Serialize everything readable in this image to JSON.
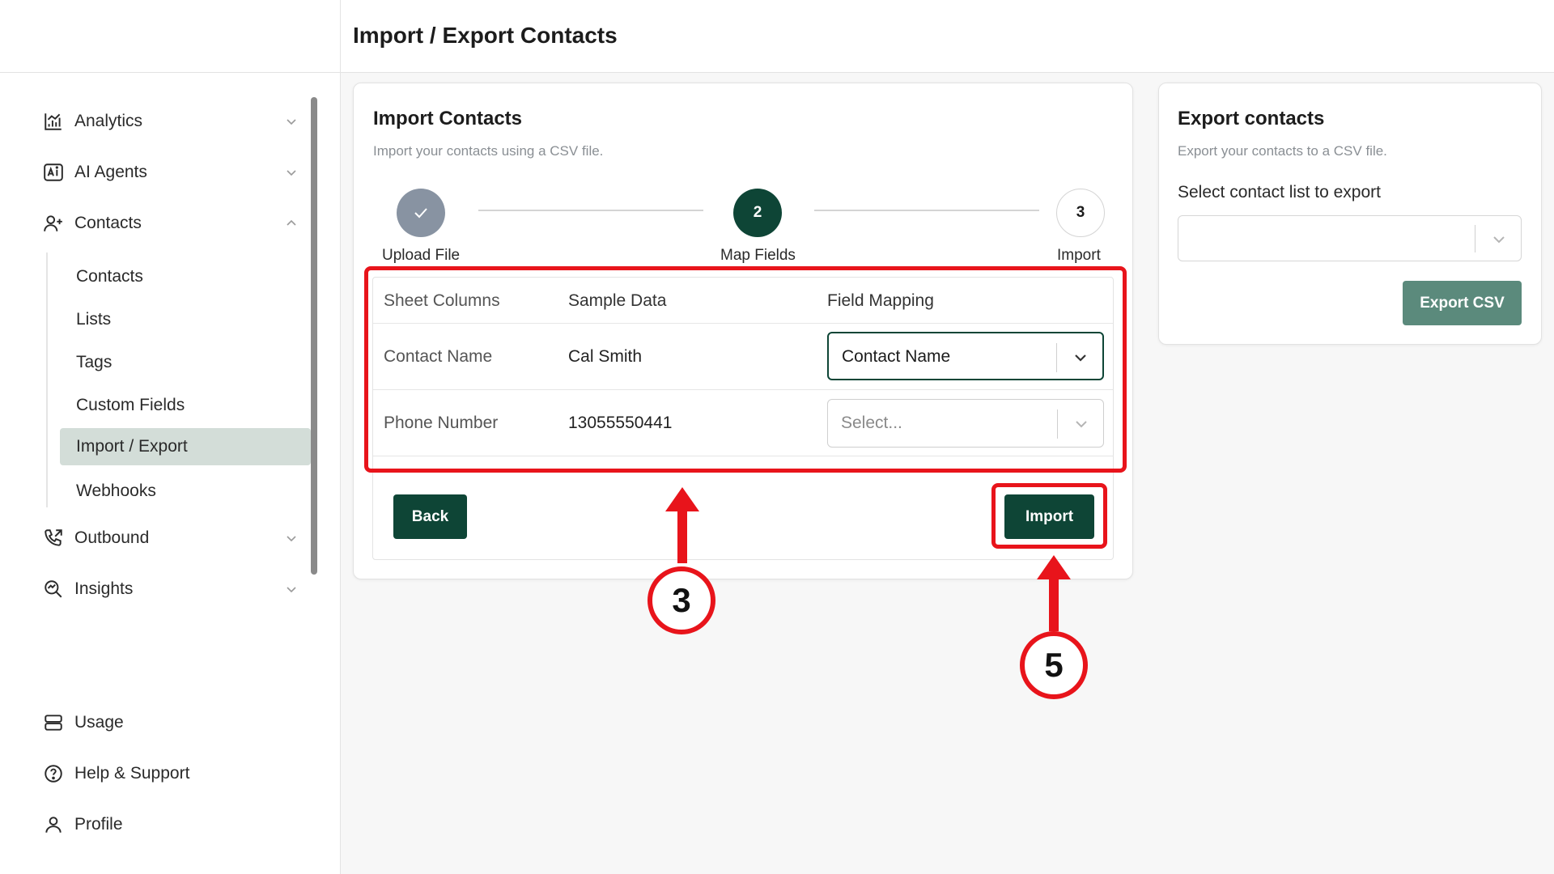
{
  "header": {
    "title": "Import / Export Contacts"
  },
  "sidebar": {
    "items": [
      {
        "label": "Analytics",
        "icon": "analytics-icon",
        "expanded": false
      },
      {
        "label": "AI Agents",
        "icon": "ai-agents-icon",
        "expanded": false
      },
      {
        "label": "Contacts",
        "icon": "contacts-icon",
        "expanded": true
      },
      {
        "label": "Outbound",
        "icon": "phone-outbound-icon",
        "expanded": false
      },
      {
        "label": "Insights",
        "icon": "insights-icon",
        "expanded": false
      }
    ],
    "contacts_sub": [
      "Contacts",
      "Lists",
      "Tags",
      "Custom Fields",
      "Import / Export",
      "Webhooks"
    ],
    "active_sub": "Import / Export",
    "bottom": [
      {
        "label": "Usage",
        "icon": "usage-icon"
      },
      {
        "label": "Help & Support",
        "icon": "help-icon"
      },
      {
        "label": "Profile",
        "icon": "profile-icon"
      }
    ]
  },
  "import_card": {
    "title": "Import Contacts",
    "subtitle": "Import your contacts using a CSV file.",
    "steps": [
      {
        "number": "",
        "label": "Upload File",
        "state": "done"
      },
      {
        "number": "2",
        "label": "Map Fields",
        "state": "active"
      },
      {
        "number": "3",
        "label": "Import",
        "state": "pending"
      }
    ],
    "table": {
      "headers": [
        "Sheet Columns",
        "Sample Data",
        "Field Mapping"
      ],
      "rows": [
        {
          "column": "Contact Name",
          "sample": "Cal Smith",
          "mapping": "Contact Name",
          "placeholder": false
        },
        {
          "column": "Phone Number",
          "sample": "13055550441",
          "mapping": "Select...",
          "placeholder": true
        }
      ]
    },
    "back_label": "Back",
    "import_label": "Import"
  },
  "export_card": {
    "title": "Export contacts",
    "subtitle": "Export your contacts to a CSV file.",
    "select_label": "Select contact list to export",
    "select_value": "",
    "button_label": "Export CSV"
  },
  "annotations": {
    "table_marker": "3",
    "import_marker": "5"
  },
  "colors": {
    "primary": "#0e4536",
    "primary_muted": "#5b8a7c",
    "done_step": "#8893a2",
    "active_nav": "#d3ddd8",
    "annotation": "#e8141b"
  }
}
